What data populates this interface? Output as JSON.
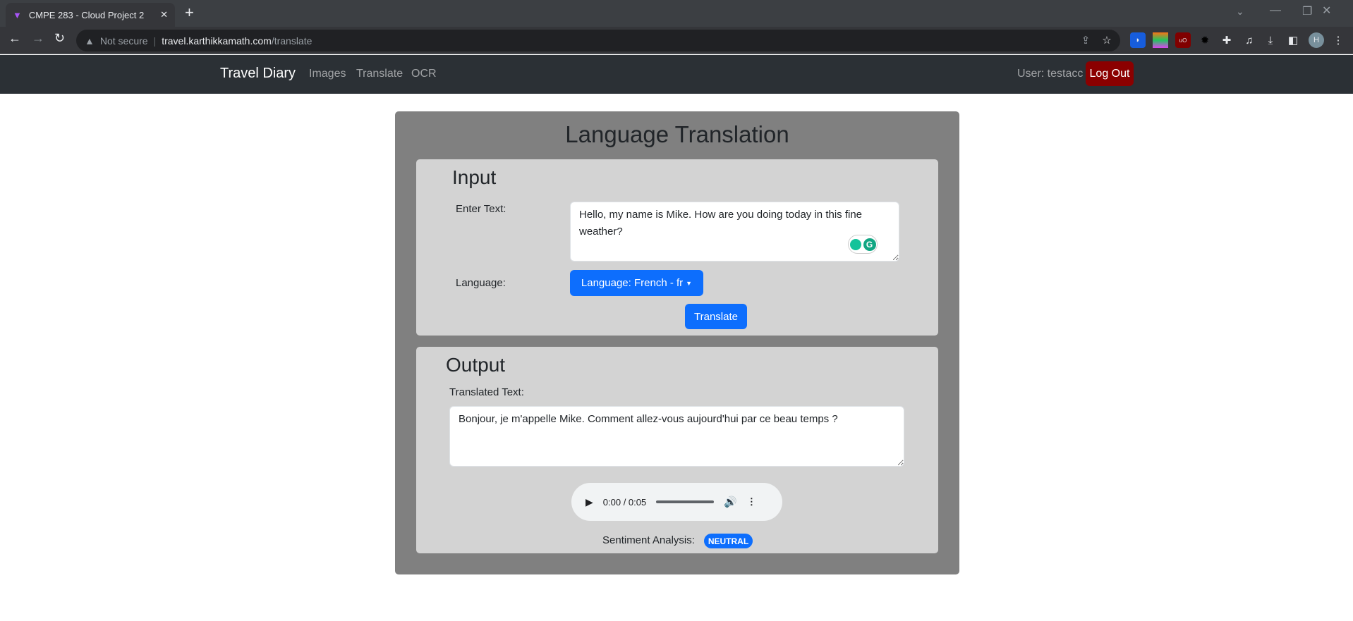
{
  "browser": {
    "tab_title": "CMPE 283 - Cloud Project 2",
    "security": "Not secure",
    "url_host": "travel.karthikkamath.com",
    "url_path": "/translate",
    "profile_initial": "H"
  },
  "navbar": {
    "brand": "Travel Diary",
    "links": [
      "Images",
      "Translate",
      "OCR"
    ],
    "user": "User: testacc",
    "logout": "Log Out"
  },
  "page": {
    "title": "Language Translation",
    "input": {
      "heading": "Input",
      "text_label": "Enter Text:",
      "text_value": "Hello, my name is Mike. How are you doing today in this fine weather?",
      "language_label": "Language:",
      "language_button": "Language: French - fr",
      "translate_button": "Translate"
    },
    "output": {
      "heading": "Output",
      "text_label": "Translated Text:",
      "text_value": "Bonjour, je m'appelle Mike. Comment allez-vous aujourd'hui par ce beau temps ?",
      "audio_time": "0:00 / 0:05",
      "sentiment_label": "Sentiment Analysis:",
      "sentiment_value": "NEUTRAL"
    }
  },
  "colors": {
    "navbar": "#2b3035",
    "logout": "#8b0000",
    "primary": "#0d6efd",
    "card": "#808080",
    "panel": "#d3d3d3"
  }
}
